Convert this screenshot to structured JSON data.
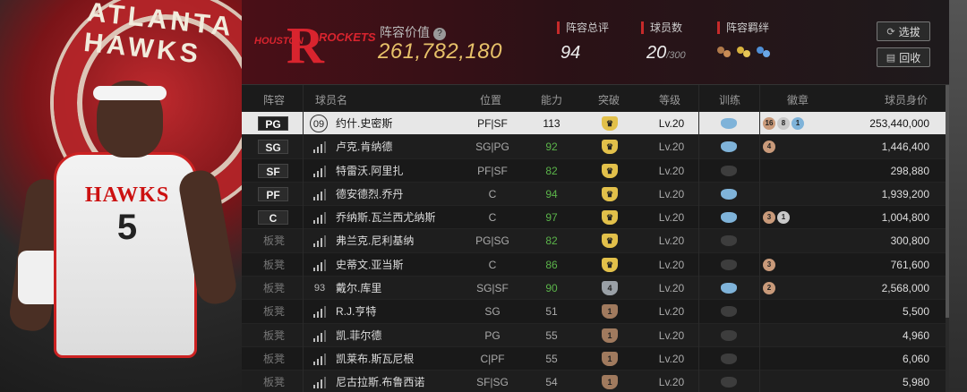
{
  "hero": {
    "team_text": "ATLANTA HAWKS",
    "jersey_team": "HAWKS",
    "jersey_number": "5"
  },
  "header": {
    "logo_left": "HOUSTON",
    "logo_right": "ROCKETS",
    "value_label": "阵容价值",
    "value_help": "?",
    "value": "261,782,180",
    "rating_label": "阵容总评",
    "rating": "94",
    "players_label": "球员数",
    "players_count": "20",
    "players_max": "/300",
    "bond_label": "阵容羁绊",
    "filter_button": "选拔",
    "recycle_button": "回收"
  },
  "table": {
    "headers": [
      "阵容",
      "球员名",
      "位置",
      "能力",
      "突破",
      "等级",
      "训练",
      "徽章",
      "球员身价"
    ],
    "rows": [
      {
        "slot": "PG",
        "bench": false,
        "num": "09",
        "name": "约什.史密斯",
        "pos": "PF|SF",
        "ability": "113",
        "breach": "crown",
        "level": "Lv.20",
        "train": "blue",
        "badges": [
          "16",
          "8",
          "1"
        ],
        "price": "253,440,000"
      },
      {
        "slot": "SG",
        "bench": false,
        "num": "",
        "name": "卢克.肯纳德",
        "pos": "SG|PG",
        "ability": "92",
        "breach": "crown",
        "level": "Lv.20",
        "train": "blue",
        "badges": [
          "4"
        ],
        "price": "1,446,400"
      },
      {
        "slot": "SF",
        "bench": false,
        "num": "",
        "name": "特雷沃.阿里扎",
        "pos": "PF|SF",
        "ability": "82",
        "breach": "crown",
        "level": "Lv.20",
        "train": "grey",
        "badges": [],
        "price": "298,880"
      },
      {
        "slot": "PF",
        "bench": false,
        "num": "",
        "name": "德安德烈.乔丹",
        "pos": "C",
        "ability": "94",
        "breach": "crown",
        "level": "Lv.20",
        "train": "blue",
        "badges": [],
        "price": "1,939,200"
      },
      {
        "slot": "C",
        "bench": false,
        "num": "",
        "name": "乔纳斯.瓦兰西尤纳斯",
        "pos": "C",
        "ability": "97",
        "breach": "crown",
        "level": "Lv.20",
        "train": "blue",
        "badges": [
          "3",
          "1"
        ],
        "price": "1,004,800"
      },
      {
        "slot": "板凳",
        "bench": true,
        "num": "",
        "name": "弗兰克.尼利基纳",
        "pos": "PG|SG",
        "ability": "82",
        "breach": "crown",
        "level": "Lv.20",
        "train": "grey",
        "badges": [],
        "price": "300,800"
      },
      {
        "slot": "板凳",
        "bench": true,
        "num": "",
        "name": "史蒂文.亚当斯",
        "pos": "C",
        "ability": "86",
        "breach": "crown",
        "level": "Lv.20",
        "train": "grey",
        "badges": [
          "3"
        ],
        "price": "761,600"
      },
      {
        "slot": "板凳",
        "bench": true,
        "num": "93",
        "name": "戴尔.库里",
        "pos": "SG|SF",
        "ability": "90",
        "breach": "4",
        "level": "Lv.20",
        "train": "blue",
        "badges": [
          "2"
        ],
        "price": "2,568,000"
      },
      {
        "slot": "板凳",
        "bench": true,
        "num": "",
        "name": "R.J.亨特",
        "pos": "SG",
        "ability": "51",
        "breach": "1",
        "level": "Lv.20",
        "train": "grey",
        "badges": [],
        "price": "5,500"
      },
      {
        "slot": "板凳",
        "bench": true,
        "num": "",
        "name": "凯.菲尔德",
        "pos": "PG",
        "ability": "55",
        "breach": "1",
        "level": "Lv.20",
        "train": "grey",
        "badges": [],
        "price": "4,960"
      },
      {
        "slot": "板凳",
        "bench": true,
        "num": "",
        "name": "凯莱布.斯瓦尼根",
        "pos": "C|PF",
        "ability": "55",
        "breach": "1",
        "level": "Lv.20",
        "train": "grey",
        "badges": [],
        "price": "6,060"
      },
      {
        "slot": "板凳",
        "bench": true,
        "num": "",
        "name": "尼古拉斯.布鲁西诺",
        "pos": "SF|SG",
        "ability": "54",
        "breach": "1",
        "level": "Lv.20",
        "train": "grey",
        "badges": [],
        "price": "5,980"
      }
    ]
  },
  "colors": {
    "gold": "#e7c169",
    "accent_red": "#c62a2a",
    "green": "#5bb44a",
    "train_blue": "#7fb3d9",
    "crown_gold": "#e2c04a"
  }
}
